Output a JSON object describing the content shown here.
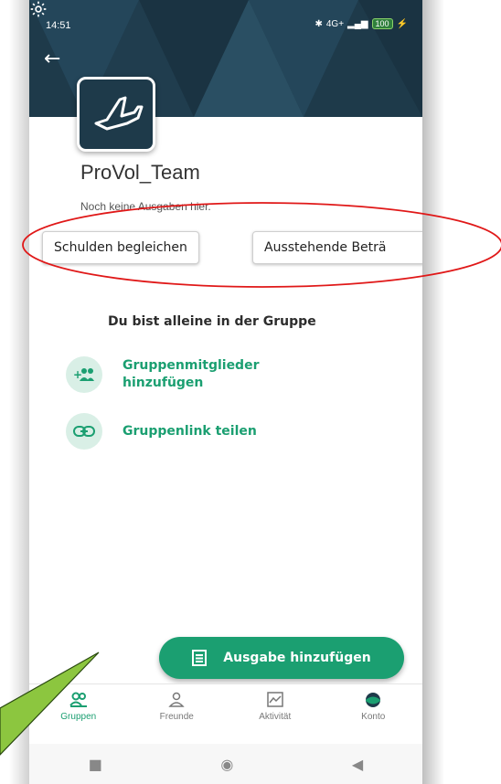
{
  "status_bar": {
    "time": "14:51",
    "battery": "100",
    "net": "4G+"
  },
  "header": {
    "back_icon": "arrow-left-icon",
    "settings_icon": "gear-icon"
  },
  "group": {
    "name": "ProVol_Team",
    "subtitle": "Noch keine Ausgaben hier."
  },
  "actions_row": {
    "settle_label": "Schulden begleichen",
    "pending_label": "Ausstehende Beträ"
  },
  "empty_state": {
    "title": "Du bist alleine in der Gruppe",
    "add_members": "Gruppenmitglieder hinzufügen",
    "share_link": "Gruppenlink teilen"
  },
  "fab": {
    "label": "Ausgabe hinzufügen"
  },
  "bottom_nav": [
    {
      "label": "Gruppen",
      "icon": "groups-icon",
      "active": true
    },
    {
      "label": "Freunde",
      "icon": "person-icon"
    },
    {
      "label": "Aktivität",
      "icon": "activity-icon"
    },
    {
      "label": "Konto",
      "icon": "account-icon"
    }
  ],
  "colors": {
    "accent": "#1b9f71",
    "header": "#1e3a4a",
    "annotation_red": "#e01818",
    "arrow_green": "#8cc63f"
  }
}
